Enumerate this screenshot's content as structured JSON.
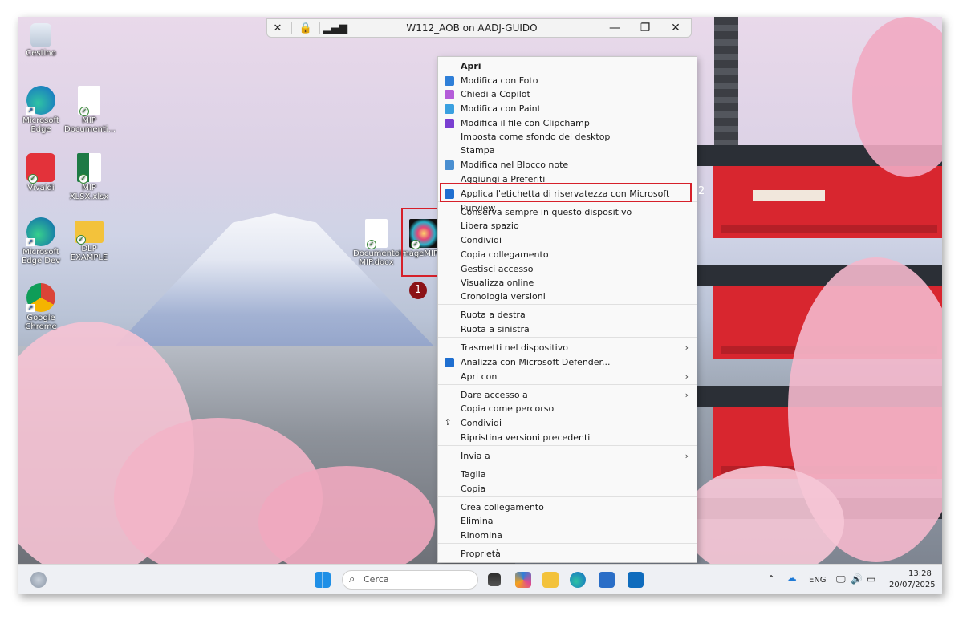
{
  "rdp_bar": {
    "title": "W112_AOB on AADJ-GUIDO",
    "icons": [
      "unpin-icon",
      "lock-icon",
      "signal-icon"
    ],
    "minimize": "—",
    "restore": "❐",
    "close": "✕"
  },
  "desktop_icons": [
    {
      "label": "Cestino"
    },
    {
      "label": "Microsoft Edge"
    },
    {
      "label": "MIP Documenti..."
    },
    {
      "label": "Vivaldi"
    },
    {
      "label": "MIP XLSX.xlsx"
    },
    {
      "label": "Microsoft Edge Dev"
    },
    {
      "label": "DLP EXAMPLE"
    },
    {
      "label": "Google Chrome"
    },
    {
      "label": "Documento MIP.docx"
    },
    {
      "label": "ImageMIP.jpg"
    }
  ],
  "callouts": {
    "one": "1",
    "two": "2"
  },
  "context_menu": {
    "items": [
      {
        "label": "Apri",
        "icon": ""
      },
      {
        "label": "Modifica con Foto",
        "icon": "photos-icon",
        "color": "#2f7fd8"
      },
      {
        "label": "Chiedi a Copilot",
        "icon": "copilot-icon",
        "color": "#b45cd9"
      },
      {
        "label": "Modifica con Paint",
        "icon": "paint-icon",
        "color": "#3aa0e0"
      },
      {
        "label": "Modifica il file con Clipchamp",
        "icon": "clipchamp-icon",
        "color": "#7a3fd1"
      },
      {
        "label": "Imposta come sfondo del desktop",
        "icon": ""
      },
      {
        "label": "Stampa",
        "icon": ""
      },
      {
        "label": "Modifica nel Blocco note",
        "icon": "notepad-icon",
        "color": "#4a8fd1"
      },
      {
        "label": "Aggiungi a Preferiti",
        "icon": ""
      },
      {
        "label": "Applica l'etichetta di riservatezza con Microsoft Purview",
        "icon": "purview-icon",
        "color": "#1f6fd0"
      },
      {
        "label": "Conserva sempre in questo dispositivo",
        "icon": ""
      },
      {
        "label": "Libera spazio",
        "icon": ""
      },
      {
        "label": "Condividi",
        "icon": ""
      },
      {
        "label": "Copia collegamento",
        "icon": ""
      },
      {
        "label": "Gestisci accesso",
        "icon": ""
      },
      {
        "label": "Visualizza online",
        "icon": ""
      },
      {
        "label": "Cronologia versioni",
        "icon": ""
      },
      {
        "label": "Ruota a destra",
        "icon": ""
      },
      {
        "label": "Ruota a sinistra",
        "icon": ""
      },
      {
        "label": "Trasmetti nel dispositivo",
        "icon": "",
        "submenu": true
      },
      {
        "label": "Analizza con Microsoft Defender...",
        "icon": "defender-icon",
        "color": "#1f6fd0"
      },
      {
        "label": "Apri con",
        "icon": "",
        "submenu": true
      },
      {
        "label": "Dare accesso a",
        "icon": "",
        "submenu": true
      },
      {
        "label": "Copia come percorso",
        "icon": ""
      },
      {
        "label": "Condividi",
        "icon": "share-icon"
      },
      {
        "label": "Ripristina versioni precedenti",
        "icon": ""
      },
      {
        "label": "Invia a",
        "icon": "",
        "submenu": true
      },
      {
        "label": "Taglia",
        "icon": ""
      },
      {
        "label": "Copia",
        "icon": ""
      },
      {
        "label": "Crea collegamento",
        "icon": ""
      },
      {
        "label": "Elimina",
        "icon": ""
      },
      {
        "label": "Rinomina",
        "icon": ""
      },
      {
        "label": "Proprietà",
        "icon": ""
      }
    ],
    "submenu_arrow": "›"
  },
  "taskbar": {
    "search_placeholder": "Cerca",
    "language": "ENG",
    "time": "13:28",
    "date": "20/07/2025"
  },
  "colors": {
    "highlight_box": "#d6202a",
    "callout_badge": "#8b1217"
  }
}
